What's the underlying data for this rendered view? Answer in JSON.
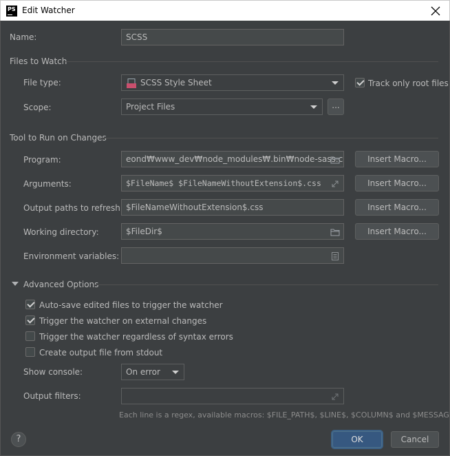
{
  "window": {
    "title": "Edit Watcher",
    "app_icon_text": "PS"
  },
  "name_row": {
    "label": "Name:",
    "value": "SCSS"
  },
  "files_to_watch": {
    "section_label": "Files to Watch",
    "file_type_label": "File type:",
    "file_type_value": "SCSS Style Sheet",
    "file_type_icon_text": "SCSS",
    "track_only_root_label": "Track only root files",
    "track_only_root_checked": true,
    "scope_label": "Scope:",
    "scope_value": "Project Files",
    "scope_browse_label": "..."
  },
  "tool": {
    "section_label": "Tool to Run on Changes",
    "program_label": "Program:",
    "program_value": "eond₩www_dev₩node_modules₩.bin₩node-sass.cmd",
    "arguments_label": "Arguments:",
    "arguments_value": "$FileName$ $FileNameWithoutExtension$.css",
    "output_paths_label": "Output paths to refresh:",
    "output_paths_value": "$FileNameWithoutExtension$.css",
    "working_dir_label": "Working directory:",
    "working_dir_value": "$FileDir$",
    "env_vars_label": "Environment variables:",
    "env_vars_value": "",
    "insert_macro_label": "Insert Macro..."
  },
  "advanced": {
    "section_label": "Advanced Options",
    "options": [
      {
        "label": "Auto-save edited files to trigger the watcher",
        "checked": true
      },
      {
        "label": "Trigger the watcher on external changes",
        "checked": true
      },
      {
        "label": "Trigger the watcher regardless of syntax errors",
        "checked": false
      },
      {
        "label": "Create output file from stdout",
        "checked": false
      }
    ],
    "show_console_label": "Show console:",
    "show_console_value": "On error",
    "output_filters_label": "Output filters:",
    "output_filters_value": "",
    "hint": "Each line is a regex, available macros: $FILE_PATH$, $LINE$, $COLUMN$ and $MESSAGE$"
  },
  "footer": {
    "help_label": "?",
    "ok_label": "OK",
    "cancel_label": "Cancel"
  },
  "colors": {
    "background": "#3c3f41",
    "primary_button": "#365880",
    "field": "#45494a",
    "text": "#bbbbbb"
  }
}
